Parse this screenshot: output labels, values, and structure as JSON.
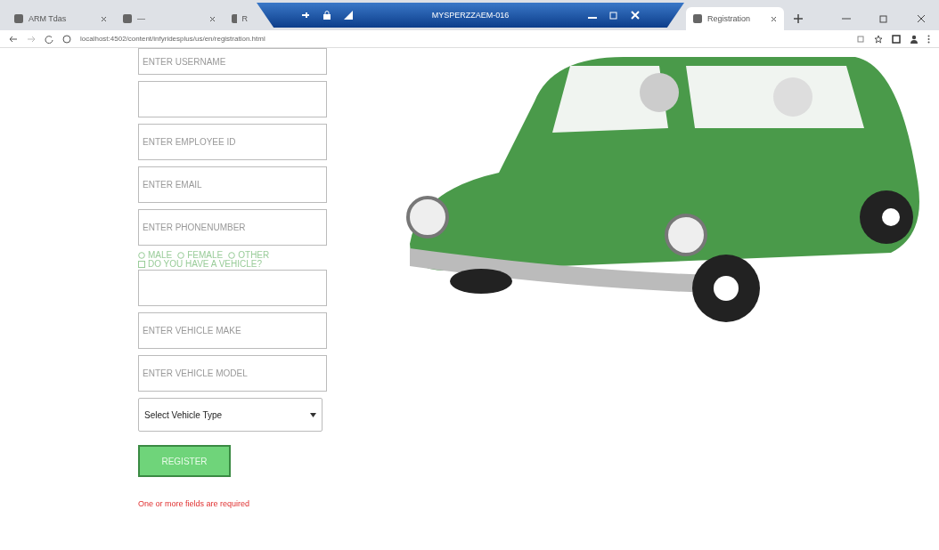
{
  "browser": {
    "tabs": [
      {
        "title": "ARM Tdas",
        "selected": false
      },
      {
        "title": "—",
        "selected": false
      },
      {
        "title": "R",
        "selected": false
      },
      {
        "title": "Registration",
        "selected": true
      }
    ],
    "url": "localhost:4502/content/infyridesplus/us/en/registration.html"
  },
  "remote_bar": {
    "title": "MYSPERZZAEM-016"
  },
  "form": {
    "fields": [
      {
        "kind": "text",
        "placeholder": "ENTER USERNAME"
      },
      {
        "kind": "text"
      },
      {
        "kind": "text",
        "placeholder": "ENTER EMPLOYEE ID"
      },
      {
        "kind": "text",
        "placeholder": "ENTER EMAIL"
      },
      {
        "kind": "text",
        "placeholder": "ENTER PHONENUMBER"
      },
      {
        "kind": "radios",
        "options": [
          {
            "label": "MALE",
            "selected": false
          },
          {
            "label": "FEMALE",
            "selected": false
          },
          {
            "label": "OTHER",
            "selected": false
          }
        ]
      },
      {
        "kind": "checkbox",
        "label": "DO YOU HAVE A VEHICLE?",
        "checked": false
      },
      {
        "kind": "text"
      },
      {
        "kind": "text",
        "placeholder": "ENTER VEHICLE MAKE"
      },
      {
        "kind": "text",
        "placeholder": "ENTER VEHICLE MODEL"
      },
      {
        "kind": "select",
        "value": "Select Vehicle Type"
      }
    ],
    "button": "REGISTER",
    "error": "One or more fields are required"
  }
}
